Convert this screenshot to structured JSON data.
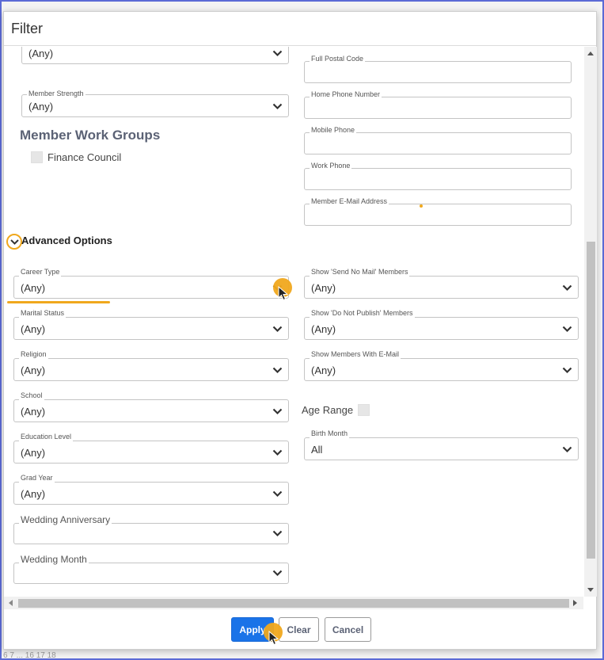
{
  "window": {
    "title": "Filter"
  },
  "colors": {
    "accent": "#f0a81d",
    "primary_button": "#1a73e8",
    "section_title": "#5b6275"
  },
  "top_left": {
    "first_select": {
      "value": "(Any)"
    },
    "member_strength": {
      "label": "Member Strength",
      "value": "(Any)"
    },
    "work_groups": {
      "title": "Member Work Groups",
      "items": [
        {
          "label": "Finance Council",
          "checked": false
        }
      ]
    }
  },
  "top_right": {
    "full_postal_code": {
      "label": "Full Postal Code",
      "value": ""
    },
    "home_phone": {
      "label": "Home Phone Number",
      "value": ""
    },
    "mobile_phone": {
      "label": "Mobile Phone",
      "value": ""
    },
    "work_phone": {
      "label": "Work Phone",
      "value": ""
    },
    "email": {
      "label": "Member E-Mail Address",
      "value": ""
    }
  },
  "advanced": {
    "label": "Advanced Options",
    "toggle_icon": "chevron-down-icon",
    "left": [
      {
        "label": "Career Type",
        "value": "(Any)"
      },
      {
        "label": "Marital Status",
        "value": "(Any)"
      },
      {
        "label": "Religion",
        "value": "(Any)"
      },
      {
        "label": "School",
        "value": "(Any)"
      },
      {
        "label": "Education Level",
        "value": "(Any)"
      },
      {
        "label": "Grad Year",
        "value": "(Any)"
      },
      {
        "label": "Wedding Anniversary",
        "value": ""
      },
      {
        "label": "Wedding Month",
        "value": ""
      }
    ],
    "right": [
      {
        "label": "Show 'Send No Mail' Members",
        "value": "(Any)"
      },
      {
        "label": "Show 'Do Not Publish' Members",
        "value": "(Any)"
      },
      {
        "label": "Show Members With E-Mail",
        "value": "(Any)"
      }
    ],
    "age_range": {
      "label": "Age Range",
      "checked": false
    },
    "birth_month": {
      "label": "Birth Month",
      "value": "All"
    }
  },
  "footer": {
    "apply": "Apply",
    "clear": "Clear",
    "cancel": "Cancel"
  },
  "background_pager": {
    "text": "6    7   ...   16    17    18"
  }
}
